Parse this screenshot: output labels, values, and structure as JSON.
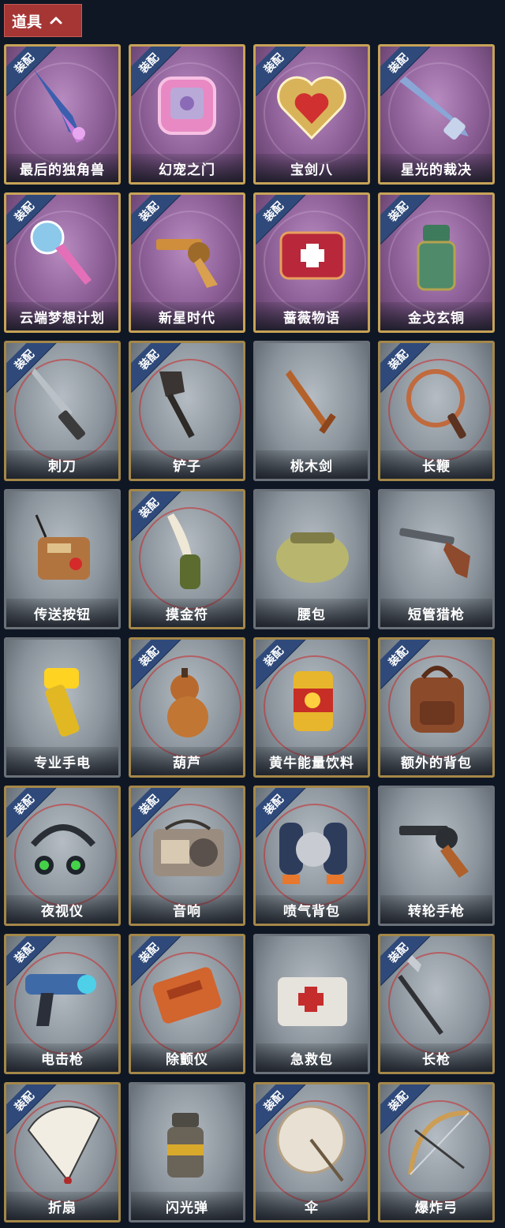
{
  "header": {
    "tab_label": "道具"
  },
  "ribbon_label": "装配",
  "items": [
    {
      "name": "最后的独角兽",
      "equipped": true,
      "rarity": "epic",
      "icon": "unicorn-horn-icon"
    },
    {
      "name": "幻宠之门",
      "equipped": true,
      "rarity": "epic",
      "icon": "pet-device-icon"
    },
    {
      "name": "宝剑八",
      "equipped": true,
      "rarity": "epic",
      "icon": "heart-shield-icon"
    },
    {
      "name": "星光的裁决",
      "equipped": true,
      "rarity": "epic",
      "icon": "starlight-rifle-icon"
    },
    {
      "name": "云端梦想计划",
      "equipped": true,
      "rarity": "epic",
      "icon": "magic-scepter-icon"
    },
    {
      "name": "新星时代",
      "equipped": true,
      "rarity": "epic",
      "icon": "revolver-icon"
    },
    {
      "name": "蔷薇物语",
      "equipped": true,
      "rarity": "epic",
      "icon": "medkit-red-icon"
    },
    {
      "name": "金戈玄铜",
      "equipped": true,
      "rarity": "epic",
      "icon": "bronze-grenade-icon"
    },
    {
      "name": "刺刀",
      "equipped": true,
      "rarity": "normal",
      "icon": "bayonet-icon"
    },
    {
      "name": "铲子",
      "equipped": true,
      "rarity": "normal",
      "icon": "shovel-icon"
    },
    {
      "name": "桃木剑",
      "equipped": false,
      "rarity": "plain",
      "icon": "wooden-sword-icon"
    },
    {
      "name": "长鞭",
      "equipped": true,
      "rarity": "normal",
      "icon": "whip-icon"
    },
    {
      "name": "传送按钮",
      "equipped": false,
      "rarity": "plain",
      "icon": "teleport-button-icon"
    },
    {
      "name": "摸金符",
      "equipped": true,
      "rarity": "normal",
      "icon": "amulet-icon"
    },
    {
      "name": "腰包",
      "equipped": false,
      "rarity": "plain",
      "icon": "waist-bag-icon"
    },
    {
      "name": "短管猎枪",
      "equipped": false,
      "rarity": "plain",
      "icon": "shotgun-icon"
    },
    {
      "name": "专业手电",
      "equipped": false,
      "rarity": "plain",
      "icon": "flashlight-icon"
    },
    {
      "name": "葫芦",
      "equipped": true,
      "rarity": "normal",
      "icon": "gourd-icon"
    },
    {
      "name": "黄牛能量饮料",
      "equipped": true,
      "rarity": "normal",
      "icon": "energy-drink-icon"
    },
    {
      "name": "额外的背包",
      "equipped": true,
      "rarity": "normal",
      "icon": "backpack-icon"
    },
    {
      "name": "夜视仪",
      "equipped": true,
      "rarity": "normal",
      "icon": "night-vision-icon"
    },
    {
      "name": "音响",
      "equipped": true,
      "rarity": "normal",
      "icon": "radio-speaker-icon"
    },
    {
      "name": "喷气背包",
      "equipped": true,
      "rarity": "normal",
      "icon": "jetpack-icon"
    },
    {
      "name": "转轮手枪",
      "equipped": false,
      "rarity": "plain",
      "icon": "revolver-pistol-icon"
    },
    {
      "name": "电击枪",
      "equipped": true,
      "rarity": "normal",
      "icon": "taser-gun-icon"
    },
    {
      "name": "除颤仪",
      "equipped": true,
      "rarity": "normal",
      "icon": "defibrillator-icon"
    },
    {
      "name": "急救包",
      "equipped": false,
      "rarity": "plain",
      "icon": "first-aid-kit-icon"
    },
    {
      "name": "长枪",
      "equipped": true,
      "rarity": "normal",
      "icon": "spear-icon"
    },
    {
      "name": "折扇",
      "equipped": true,
      "rarity": "normal",
      "icon": "folding-fan-icon"
    },
    {
      "name": "闪光弹",
      "equipped": false,
      "rarity": "plain",
      "icon": "flashbang-icon"
    },
    {
      "name": "伞",
      "equipped": true,
      "rarity": "normal",
      "icon": "umbrella-icon"
    },
    {
      "name": "爆炸弓",
      "equipped": true,
      "rarity": "normal",
      "icon": "explosive-bow-icon"
    }
  ]
}
